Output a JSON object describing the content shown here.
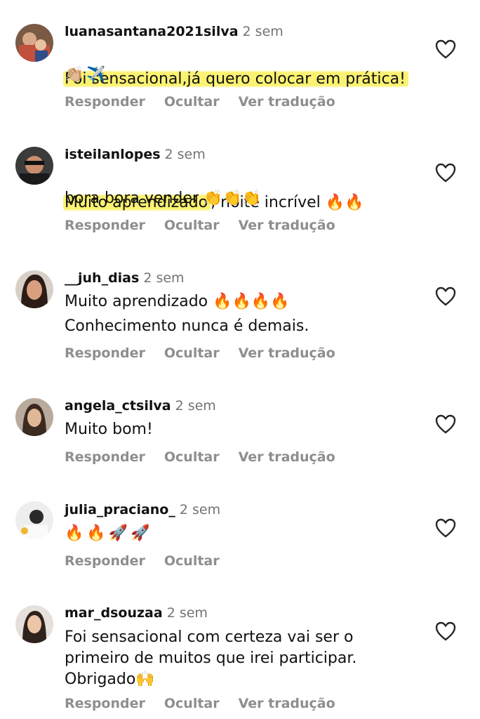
{
  "actions": {
    "reply": "Responder",
    "hide": "Ocultar",
    "translate": "Ver tradução"
  },
  "comments": [
    {
      "username": "luanasantana2021silva",
      "time": "2 sem",
      "highlight": "Foi sensacional,já quero colocar em prática!",
      "rest": "",
      "line2": "👏🏼✈️"
    },
    {
      "username": "isteilanlopes",
      "time": "2 sem",
      "highlight": "Muito aprendizado",
      "rest": ", noite incrível 🔥🔥",
      "line2": "bora bora vender 👏👏👏"
    },
    {
      "username": "__juh_dias",
      "time": "2 sem",
      "line1": "Muito aprendizado 🔥🔥🔥🔥",
      "line2": "Conhecimento nunca é demais."
    },
    {
      "username": "angela_ctsilva",
      "time": "2 sem",
      "line1": "Muito bom!"
    },
    {
      "username": "julia_praciano_",
      "time": "2 sem",
      "line1": "🔥🔥🚀🚀"
    },
    {
      "username": "mar_dsouzaa",
      "time": "2 sem",
      "line1": "Foi sensacional com certeza  vai ser o",
      "line2": "primeiro de muitos que irei participar.",
      "line3": "Obrigado🙌"
    }
  ]
}
